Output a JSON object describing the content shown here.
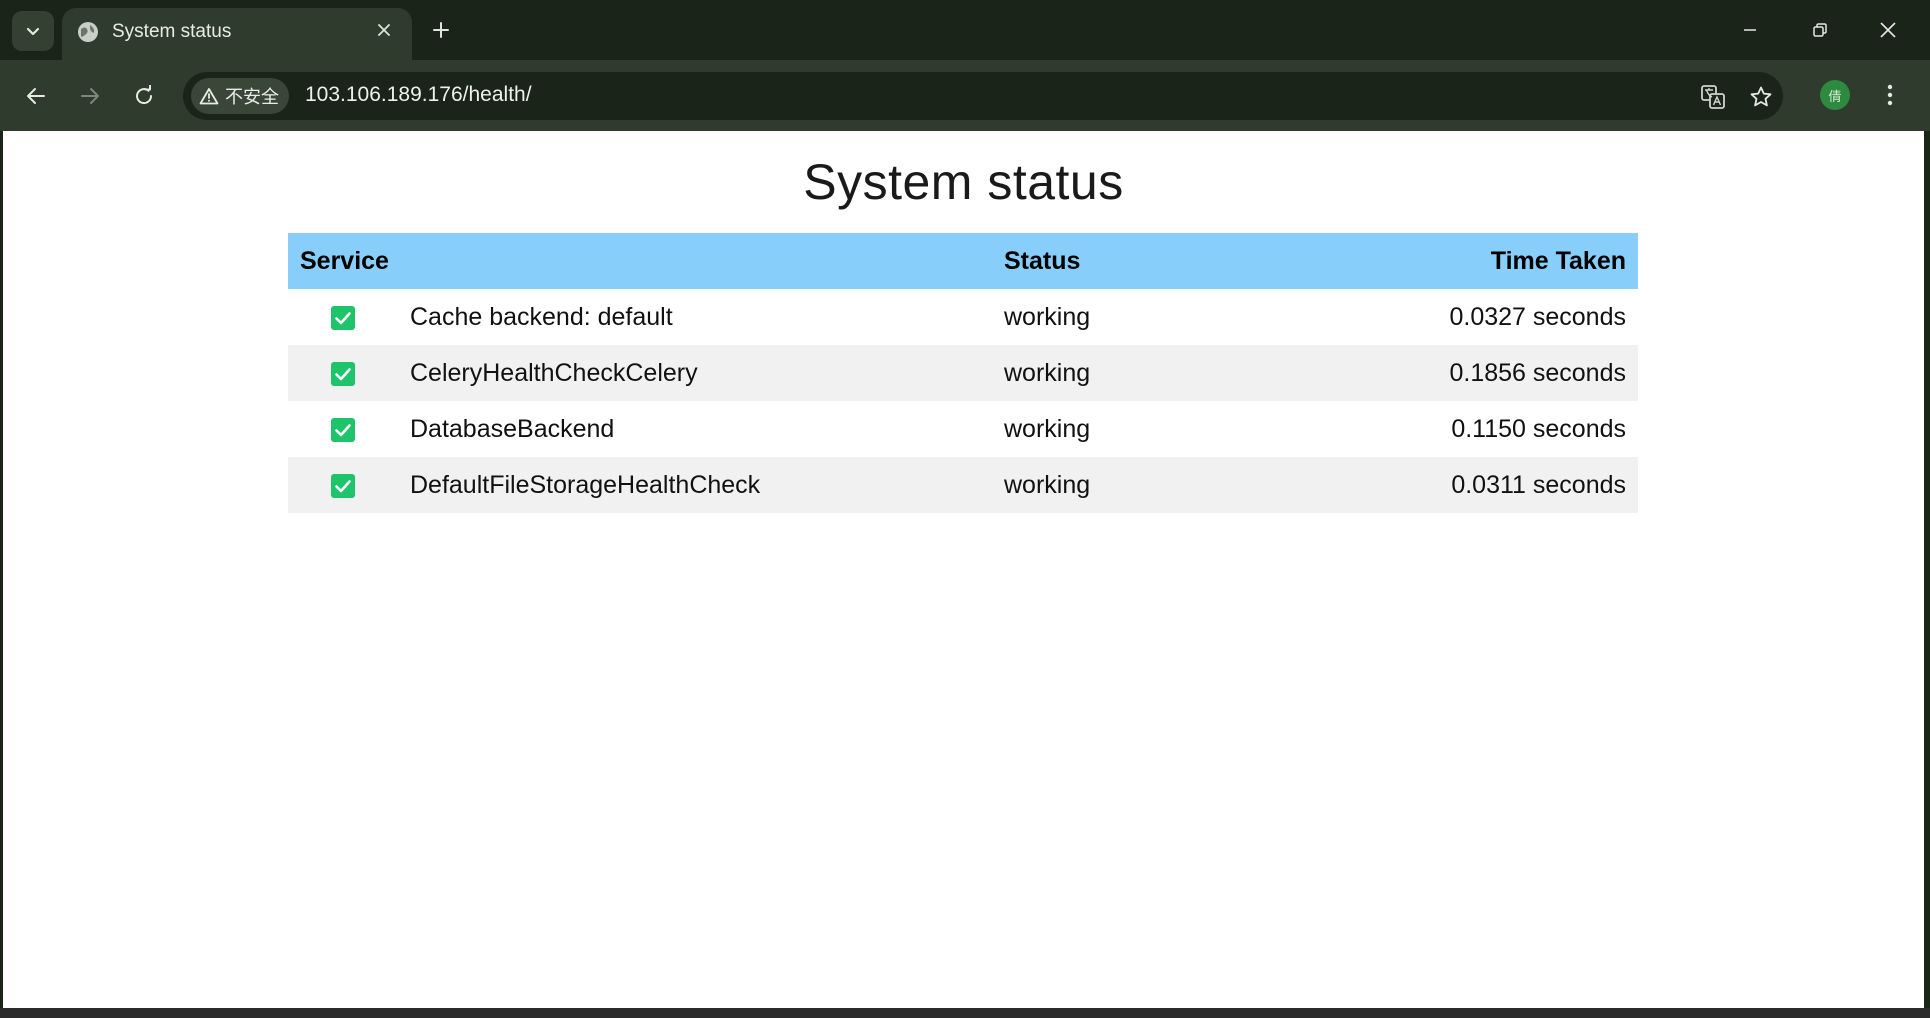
{
  "browser": {
    "tab": {
      "title": "System status"
    },
    "address_bar": {
      "security_label": "不安全",
      "url": "103.106.189.176/health/"
    },
    "profile_initial": "倩"
  },
  "page": {
    "title": "System status",
    "table": {
      "headers": {
        "service": "Service",
        "status": "Status",
        "time_taken": "Time Taken"
      },
      "rows": [
        {
          "service": "Cache backend: default",
          "status": "working",
          "time": "0.0327 seconds"
        },
        {
          "service": "CeleryHealthCheckCelery",
          "status": "working",
          "time": "0.1856 seconds"
        },
        {
          "service": "DatabaseBackend",
          "status": "working",
          "time": "0.1150 seconds"
        },
        {
          "service": "DefaultFileStorageHealthCheck",
          "status": "working",
          "time": "0.0311 seconds"
        }
      ]
    }
  },
  "colors": {
    "header_bg": "#87cefa",
    "check_green": "#1ec46a",
    "stripe": "#f1f1f1"
  },
  "icons": [
    "tab-search-icon",
    "globe-icon",
    "close-icon",
    "plus-icon",
    "minimize-icon",
    "restore-icon",
    "window-close-icon",
    "back-arrow-icon",
    "forward-arrow-icon",
    "reload-icon",
    "warning-icon",
    "translate-icon",
    "star-icon",
    "kebab-menu-icon",
    "check-icon"
  ]
}
